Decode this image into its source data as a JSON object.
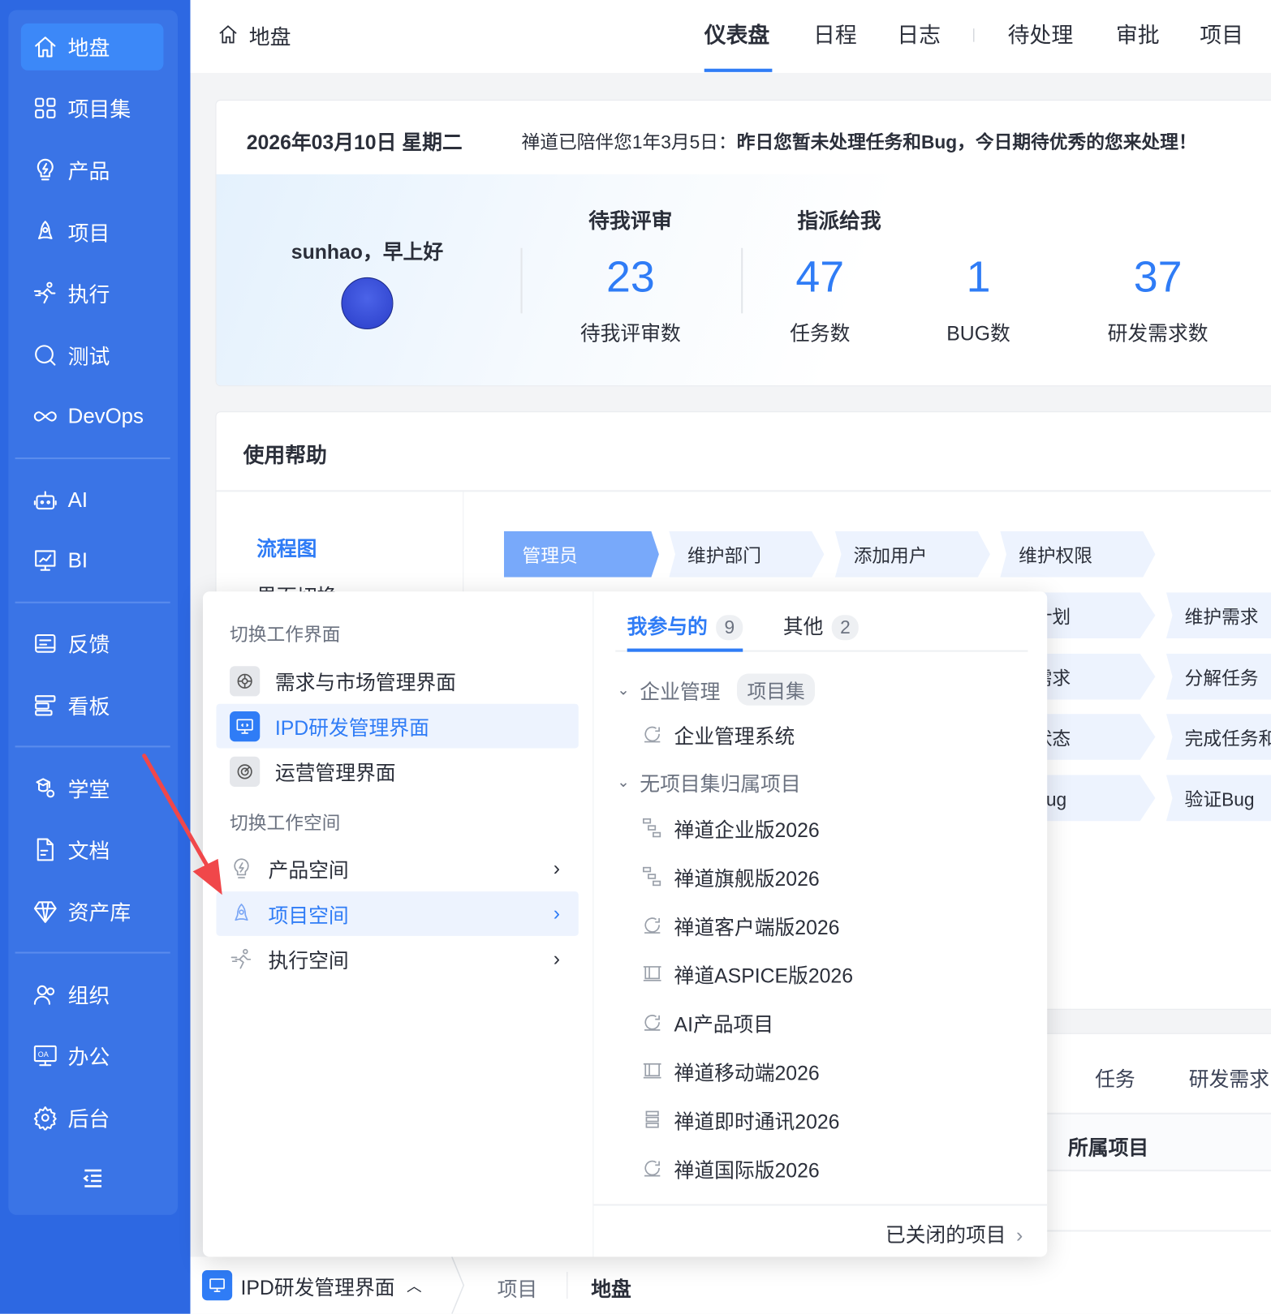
{
  "sidebar": {
    "items": [
      {
        "label": "地盘",
        "icon": "home-icon",
        "active": true
      },
      {
        "label": "项目集",
        "icon": "grid-icon"
      },
      {
        "label": "产品",
        "icon": "lightbulb-icon"
      },
      {
        "label": "项目",
        "icon": "rocket-icon"
      },
      {
        "label": "执行",
        "icon": "runner-icon"
      },
      {
        "label": "测试",
        "icon": "search-icon"
      },
      {
        "label": "DevOps",
        "icon": "infinity-icon"
      },
      {
        "label": "AI",
        "icon": "robot-icon"
      },
      {
        "label": "BI",
        "icon": "chart-board-icon"
      },
      {
        "label": "反馈",
        "icon": "feedback-icon"
      },
      {
        "label": "看板",
        "icon": "kanban-icon"
      },
      {
        "label": "学堂",
        "icon": "school-icon"
      },
      {
        "label": "文档",
        "icon": "document-icon"
      },
      {
        "label": "资产库",
        "icon": "diamond-icon"
      },
      {
        "label": "组织",
        "icon": "users-icon"
      },
      {
        "label": "办公",
        "icon": "oa-icon"
      },
      {
        "label": "后台",
        "icon": "gear-icon"
      }
    ]
  },
  "header": {
    "breadcrumb": "地盘",
    "nav": [
      "仪表盘",
      "日程",
      "日志",
      "待处理",
      "审批",
      "项目"
    ],
    "active_nav": "仪表盘"
  },
  "welcome": {
    "date": "2026年03月10日 星期二",
    "message_prefix": "禅道已陪伴您1年3月5日：",
    "message_bold": "昨日您暂未处理任务和Bug，今日期待优秀的您来处理！",
    "greeting": "sunhao，早上好",
    "review_header": "待我评审",
    "assigned_header": "指派给我",
    "stats": [
      {
        "value": "23",
        "label": "待我评审数"
      },
      {
        "value": "47",
        "label": "任务数"
      },
      {
        "value": "1",
        "label": "BUG数"
      },
      {
        "value": "37",
        "label": "研发需求数"
      }
    ]
  },
  "help": {
    "title": "使用帮助",
    "side": [
      "流程图",
      "界面切换"
    ],
    "flow_row1": [
      "管理员",
      "维护部门",
      "添加用户",
      "维护权限"
    ],
    "flow_col4": [
      "户计划",
      "联需求",
      "析状态",
      "交Bug"
    ],
    "flow_col5": [
      "维护需求",
      "分解任务",
      "完成任务和",
      "验证Bug"
    ]
  },
  "lower": {
    "tabs": [
      "任务",
      "研发需求"
    ],
    "column": "所属项目"
  },
  "bottom": {
    "switcher": "IPD研发管理界面",
    "crumb1": "项目",
    "crumb2": "地盘"
  },
  "popup": {
    "section1": "切换工作界面",
    "interfaces": [
      {
        "label": "需求与市场管理界面"
      },
      {
        "label": "IPD研发管理界面",
        "active": true
      },
      {
        "label": "运营管理界面"
      }
    ],
    "section2": "切换工作空间",
    "spaces": [
      {
        "label": "产品空间"
      },
      {
        "label": "项目空间",
        "active": true
      },
      {
        "label": "执行空间"
      }
    ],
    "tabs": [
      {
        "label": "我参与的",
        "count": "9"
      },
      {
        "label": "其他",
        "count": "2"
      }
    ],
    "group1": {
      "label": "企业管理",
      "tag": "项目集",
      "items": [
        "企业管理系统"
      ]
    },
    "group2": {
      "label": "无项目集归属项目",
      "items": [
        "禅道企业版2026",
        "禅道旗舰版2026",
        "禅道客户端版2026",
        "禅道ASPICE版2026",
        "AI产品项目",
        "禅道移动端2026",
        "禅道即时通讯2026",
        "禅道国际版2026"
      ]
    },
    "footer": "已关闭的项目"
  },
  "colors": {
    "primary": "#2f7cf6",
    "sidebar": "#2d68e2",
    "annotation_arrow": "#f0474a"
  }
}
